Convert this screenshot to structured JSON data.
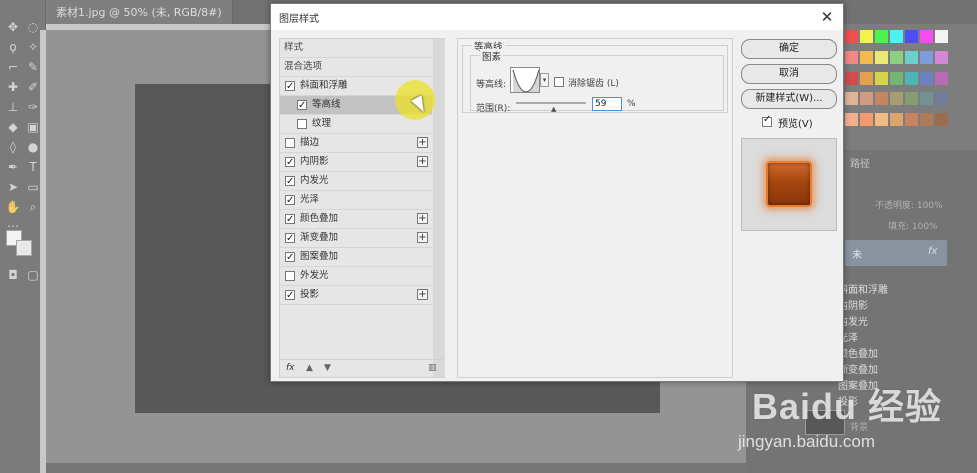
{
  "document_tab": "素材1.jpg @ 50% (未, RGB/8#)",
  "dialog": {
    "title": "图层样式",
    "close": "✕",
    "style_list": {
      "header_styles": "样式",
      "header_blend": "混合选项",
      "items": [
        {
          "label": "斜面和浮雕",
          "checked": true,
          "plus": false
        },
        {
          "label": "等高线",
          "checked": true,
          "plus": false,
          "selected": true
        },
        {
          "label": "纹理",
          "checked": false,
          "plus": false
        },
        {
          "label": "描边",
          "checked": false,
          "plus": true
        },
        {
          "label": "内阴影",
          "checked": true,
          "plus": true
        },
        {
          "label": "内发光",
          "checked": true,
          "plus": false
        },
        {
          "label": "光泽",
          "checked": true,
          "plus": false
        },
        {
          "label": "颜色叠加",
          "checked": true,
          "plus": true
        },
        {
          "label": "渐变叠加",
          "checked": true,
          "plus": true
        },
        {
          "label": "图案叠加",
          "checked": true,
          "plus": false
        },
        {
          "label": "外发光",
          "checked": false,
          "plus": false
        },
        {
          "label": "投影",
          "checked": true,
          "plus": true
        }
      ],
      "footer_fx": "fx"
    },
    "settings": {
      "group_title": "等高线",
      "sub_title": "图素",
      "contour_label": "等高线:",
      "antialias_label": "消除锯齿 (L)",
      "range_label": "范围(R):",
      "range_value": "59",
      "range_unit": "%"
    },
    "buttons": {
      "ok": "确定",
      "cancel": "取消",
      "new_style": "新建样式(W)...",
      "preview": "预览(V)"
    }
  },
  "layers_panel": {
    "tab": "路径",
    "opacity_label": "不透明度: 100%",
    "fill_label": "填充: 100%",
    "layer_name": "未",
    "layer_fx": "fx",
    "effects": [
      "斜面和浮雕",
      "内阴影",
      "内发光",
      "光泽",
      "颜色叠加",
      "渐变叠加",
      "图案叠加",
      "投影"
    ],
    "bottom_label": "背景"
  },
  "watermark": {
    "brand": "Baidu 经验",
    "url": "jingyan.baidu.com"
  },
  "colors": {
    "preview_orange": "#d16a2e",
    "highlight_yellow": "#ebe128",
    "selected_row": "#c2c2c2"
  },
  "swatch_colors": [
    "#ff0000",
    "#ffff00",
    "#00ff00",
    "#00ffff",
    "#0000ff",
    "#ff00ff",
    "#ffffff",
    "#ff5a5a",
    "#ffaa00",
    "#f0f03c",
    "#63c850",
    "#30c8c8",
    "#4a7bd9",
    "#d25ad2",
    "#c80000",
    "#e68200",
    "#d2d200",
    "#3ca03c",
    "#00a0a0",
    "#3050b0",
    "#a030a0",
    "#e0a070",
    "#c87850",
    "#b45a1e",
    "#8a7a3a",
    "#5a7a3a",
    "#3a6a6a",
    "#3a4a7a",
    "#ff9966",
    "#ff7733",
    "#ffaa55",
    "#dd8833",
    "#bb5522",
    "#994411",
    "#773300"
  ]
}
